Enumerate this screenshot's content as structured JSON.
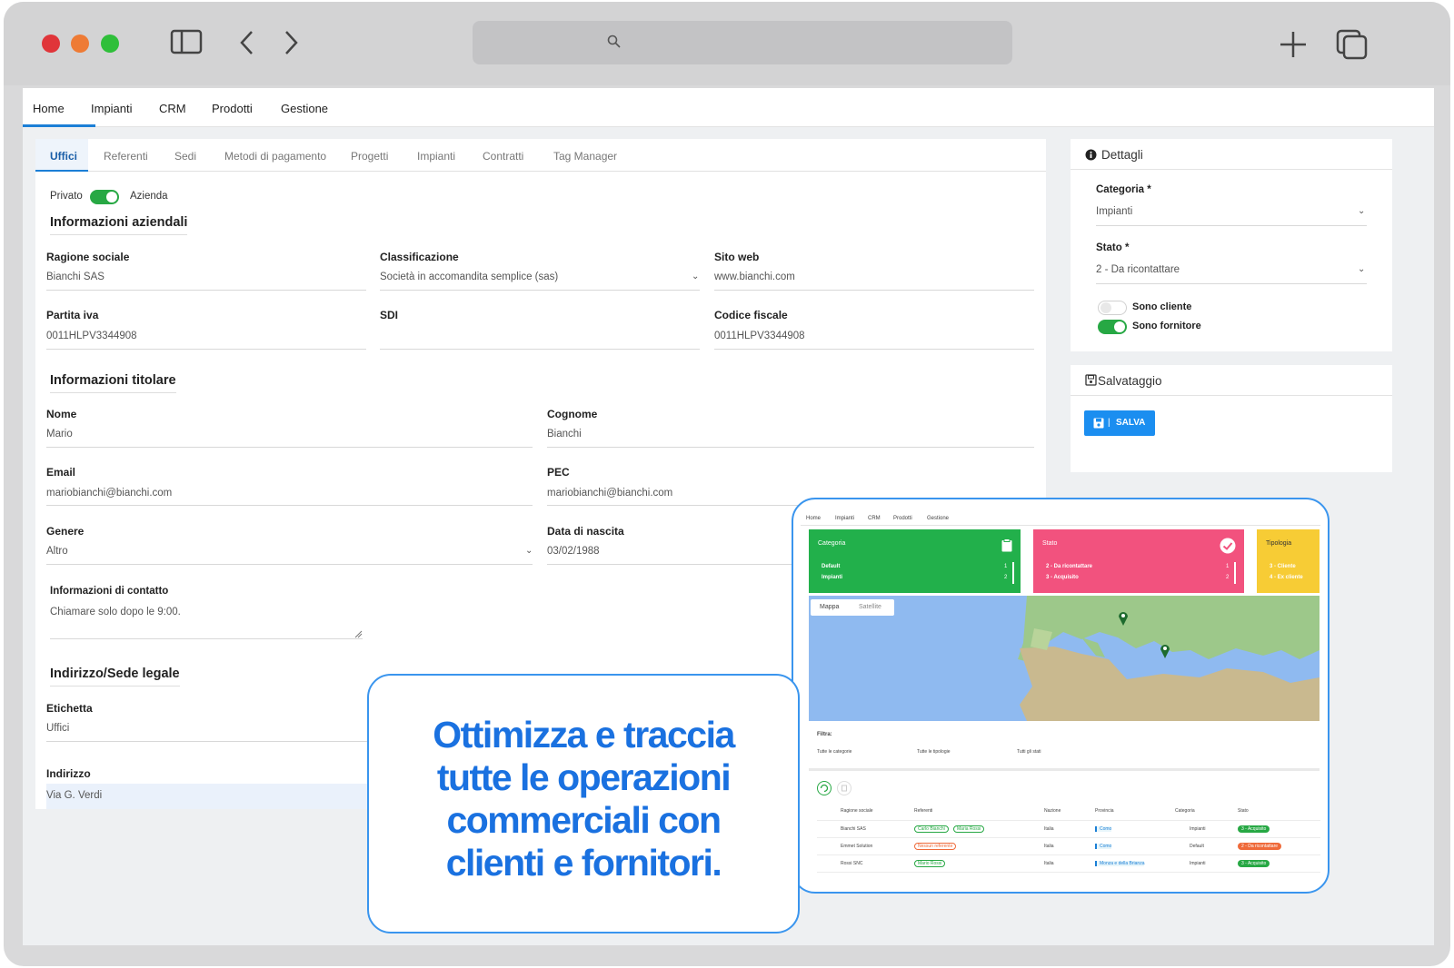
{
  "topnav": {
    "items": [
      "Home",
      "Impianti",
      "CRM",
      "Prodotti",
      "Gestione"
    ]
  },
  "tabs": [
    "Uffici",
    "Referenti",
    "Sedi",
    "Metodi di pagamento",
    "Progetti",
    "Impianti",
    "Contratti",
    "Tag Manager"
  ],
  "toggle": {
    "left": "Privato",
    "right": "Azienda"
  },
  "company": {
    "title": "Informazioni aziendali",
    "ragione_label": "Ragione sociale",
    "ragione": "Bianchi SAS",
    "class_label": "Classificazione",
    "class": "Società in accomandita semplice (sas)",
    "web_label": "Sito web",
    "web": "www.bianchi.com",
    "piva_label": "Partita iva",
    "piva": "0011HLPV3344908",
    "sdi_label": "SDI",
    "sdi": "",
    "cf_label": "Codice fiscale",
    "cf": "0011HLPV3344908"
  },
  "owner": {
    "title": "Informazioni titolare",
    "nome_label": "Nome",
    "nome": "Mario",
    "cognome_label": "Cognome",
    "cognome": "Bianchi",
    "email_label": "Email",
    "email": "mariobianchi@bianchi.com",
    "pec_label": "PEC",
    "pec": "mariobianchi@bianchi.com",
    "genere_label": "Genere",
    "genere": "Altro",
    "nascita_label": "Data di nascita",
    "nascita": "03/02/1988",
    "contatto_label": "Informazioni di contatto",
    "contatto": "Chiamare solo dopo le 9:00."
  },
  "address": {
    "title": "Indirizzo/Sede legale",
    "etichetta_label": "Etichetta",
    "etichetta": "Uffici",
    "indirizzo_label": "Indirizzo",
    "indirizzo": "Via G. Verdi"
  },
  "details": {
    "title": "Dettagli",
    "categoria_label": "Categoria *",
    "categoria": "Impianti",
    "stato_label": "Stato *",
    "stato": "2 - Da ricontattare",
    "cliente": "Sono cliente",
    "fornitore": "Sono fornitore"
  },
  "save": {
    "title": "Salvataggio",
    "button": "SALVA"
  },
  "promo": {
    "line1": "Ottimizza e traccia",
    "line2": "tutte le operazioni",
    "line3": "commerciali con",
    "line4": "clienti e fornitori."
  },
  "mini": {
    "nav": [
      "Home",
      "Impianti",
      "CRM",
      "Prodotti",
      "Gestione"
    ],
    "tile1": {
      "title": "Categoria",
      "r1": "Default",
      "v1": "1",
      "r2": "Impianti",
      "v2": "2"
    },
    "tile2": {
      "title": "Stato",
      "r1": "2 - Da ricontattare",
      "v1": "1",
      "r2": "3 - Acquisito",
      "v2": "2"
    },
    "tile3": {
      "title": "Tipologia",
      "r1": "3 - Cliente",
      "r2": "4 - Ex cliente"
    },
    "map_tabs": [
      "Mappa",
      "Satellite"
    ],
    "filter": "Filtra:",
    "filters": [
      "Tutte le categorie",
      "Tutte le tipologie",
      "Tutti gli stati"
    ],
    "headers": [
      "Ragione sociale",
      "Referenti",
      "Nazione",
      "Provincia",
      "Categoria",
      "Stato"
    ],
    "rows": [
      {
        "name": "Bianchi SAS",
        "ref": "Carlo Bianchi",
        "ref2": "Maria Rossi",
        "naz": "Italia",
        "prov": "Como",
        "cat": "Impianti",
        "stato": "3 - Acquisito"
      },
      {
        "name": "Emmet Solution",
        "ref": "Nessun referente",
        "ref2": "",
        "naz": "Italia",
        "prov": "Como",
        "cat": "Default",
        "stato": "2 - Da ricontattare"
      },
      {
        "name": "Rossi SNC",
        "ref": "Mario Rossi",
        "ref2": "",
        "naz": "Italia",
        "prov": "Monza e della Brianza",
        "cat": "Impianti",
        "stato": "3 - Acquisito"
      }
    ]
  },
  "colors": {
    "accent": "#1b7fd6",
    "green": "#27a844",
    "pink": "#f2527e",
    "yellow": "#f7cc35"
  }
}
